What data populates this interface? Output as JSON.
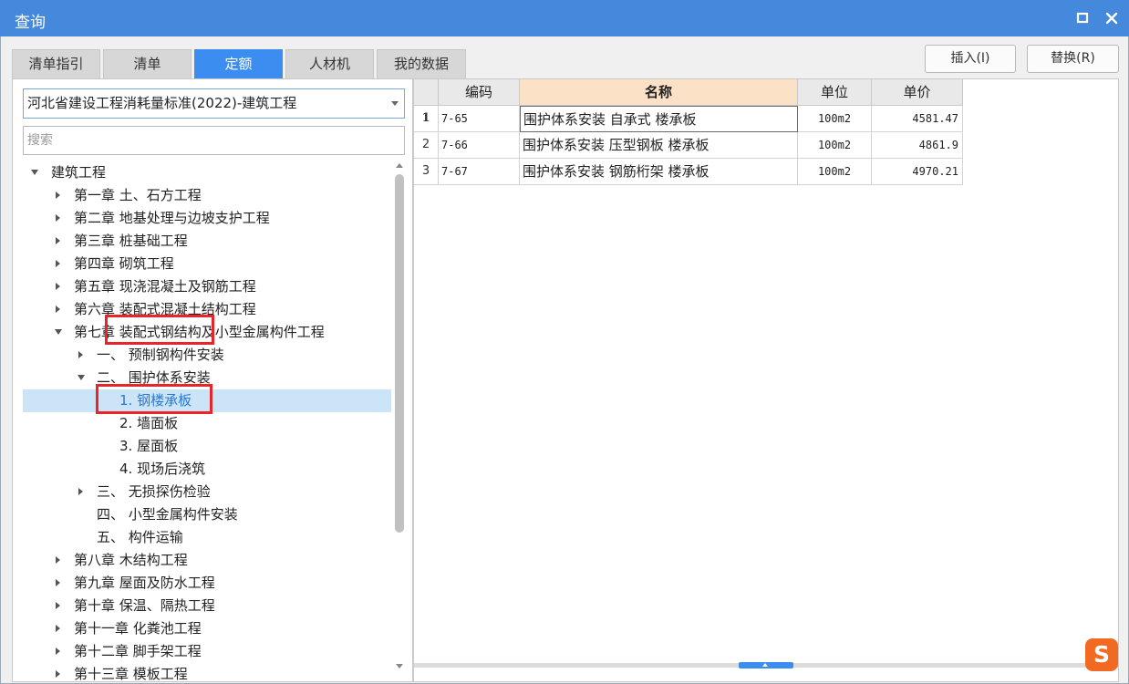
{
  "window": {
    "title": "查询"
  },
  "tabs": [
    "清单指引",
    "清单",
    "定额",
    "人材机",
    "我的数据"
  ],
  "active_tab": "定额",
  "buttons": {
    "insert": "插入(I)",
    "replace": "替换(R)"
  },
  "standard_select": {
    "value": "河北省建设工程消耗量标准(2022)-建筑工程"
  },
  "search": {
    "placeholder": "搜索"
  },
  "tree": [
    {
      "label": "建筑工程",
      "level": 0,
      "toggle": "expanded"
    },
    {
      "label": "第一章 土、石方工程",
      "level": 1,
      "toggle": "collapsed"
    },
    {
      "label": "第二章 地基处理与边坡支护工程",
      "level": 1,
      "toggle": "collapsed"
    },
    {
      "label": "第三章 桩基础工程",
      "level": 1,
      "toggle": "collapsed"
    },
    {
      "label": "第四章 砌筑工程",
      "level": 1,
      "toggle": "collapsed"
    },
    {
      "label": "第五章 现浇混凝土及钢筋工程",
      "level": 1,
      "toggle": "collapsed"
    },
    {
      "label": "第六章 装配式混凝土结构工程",
      "level": 1,
      "toggle": "collapsed"
    },
    {
      "label": "第七章 装配式钢结构及小型金属构件工程",
      "level": 1,
      "toggle": "expanded"
    },
    {
      "label": "一、  预制钢构件安装",
      "level": 2,
      "toggle": "collapsed"
    },
    {
      "label": "二、  围护体系安装",
      "level": 2,
      "toggle": "expanded"
    },
    {
      "label": "1. 钢楼承板",
      "level": 3,
      "toggle": "none",
      "selected": true
    },
    {
      "label": "2. 墙面板",
      "level": 3,
      "toggle": "none"
    },
    {
      "label": "3. 屋面板",
      "level": 3,
      "toggle": "none"
    },
    {
      "label": "4. 现场后浇筑",
      "level": 3,
      "toggle": "none"
    },
    {
      "label": "三、  无损探伤检验",
      "level": 2,
      "toggle": "collapsed"
    },
    {
      "label": "四、  小型金属构件安装",
      "level": 2,
      "toggle": "none"
    },
    {
      "label": "五、  构件运输",
      "level": 2,
      "toggle": "none"
    },
    {
      "label": "第八章 木结构工程",
      "level": 1,
      "toggle": "collapsed"
    },
    {
      "label": "第九章 屋面及防水工程",
      "level": 1,
      "toggle": "collapsed"
    },
    {
      "label": "第十章 保温、隔热工程",
      "level": 1,
      "toggle": "collapsed"
    },
    {
      "label": "第十一章 化粪池工程",
      "level": 1,
      "toggle": "collapsed"
    },
    {
      "label": "第十二章 脚手架工程",
      "level": 1,
      "toggle": "collapsed"
    },
    {
      "label": "第十三章 模板工程",
      "level": 1,
      "toggle": "collapsed"
    }
  ],
  "table": {
    "columns": [
      "编码",
      "名称",
      "单位",
      "单价"
    ],
    "rows": [
      {
        "num": "1",
        "code": "7-65",
        "name": "围护体系安装 自承式 楼承板",
        "unit": "100m2",
        "price": "4581.47"
      },
      {
        "num": "2",
        "code": "7-66",
        "name": "围护体系安装 压型钢板 楼承板",
        "unit": "100m2",
        "price": "4861.9"
      },
      {
        "num": "3",
        "code": "7-67",
        "name": "围护体系安装 钢筋桁架 楼承板",
        "unit": "100m2",
        "price": "4970.21"
      }
    ]
  },
  "ime": {
    "glyph": "S"
  },
  "colors": {
    "titlebar": "#4589dd",
    "active_tab": "#3c8df0",
    "highlight_box": "#e8262a",
    "header_highlight": "#fbe1c6",
    "selected_row": "#cce4f7"
  }
}
